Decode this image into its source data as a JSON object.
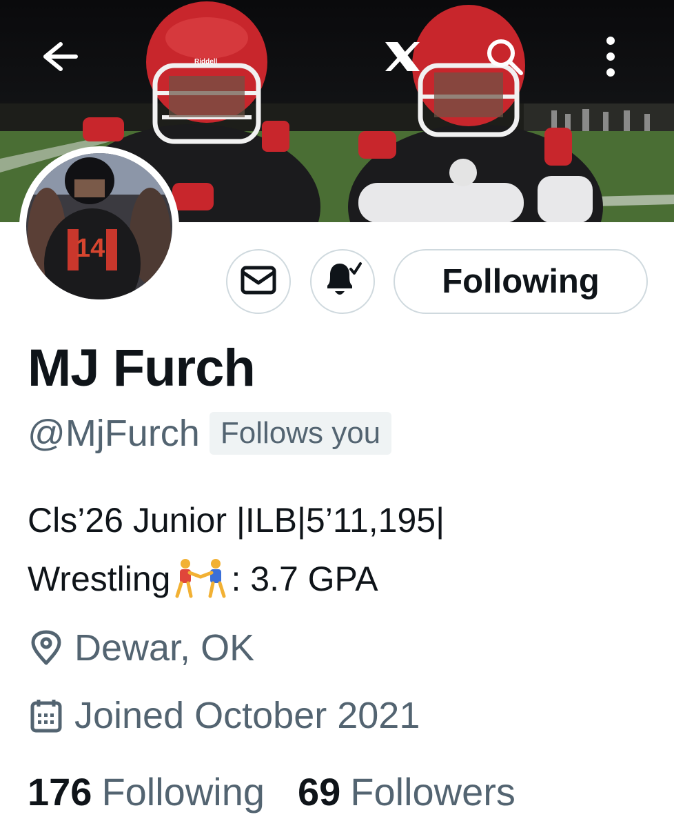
{
  "header": {
    "back_icon": "arrow-left-icon",
    "logo_icon": "x-logo-icon",
    "search_icon": "search-icon",
    "more_icon": "more-vertical-icon"
  },
  "actions": {
    "message_icon": "mail-icon",
    "notify_icon": "bell-check-icon",
    "following_label": "Following"
  },
  "profile": {
    "name": "MJ Furch",
    "handle": "@MjFurch",
    "follows_you": "Follows you",
    "bio_line1": "Cls’26 Junior |ILB|5’11,195|",
    "bio_line2_start": "Wrestling",
    "bio_line2_end": ": 3.7 GPA",
    "location": "Dewar, OK",
    "joined": "Joined October 2021"
  },
  "stats": {
    "following_count": "176",
    "following_label": "Following",
    "followers_count": "69",
    "followers_label": "Followers"
  },
  "colors": {
    "text": "#0f1419",
    "muted": "#536471",
    "border": "#cfd9de",
    "chip_bg": "#eff3f4",
    "helmet_red": "#c8262c"
  }
}
